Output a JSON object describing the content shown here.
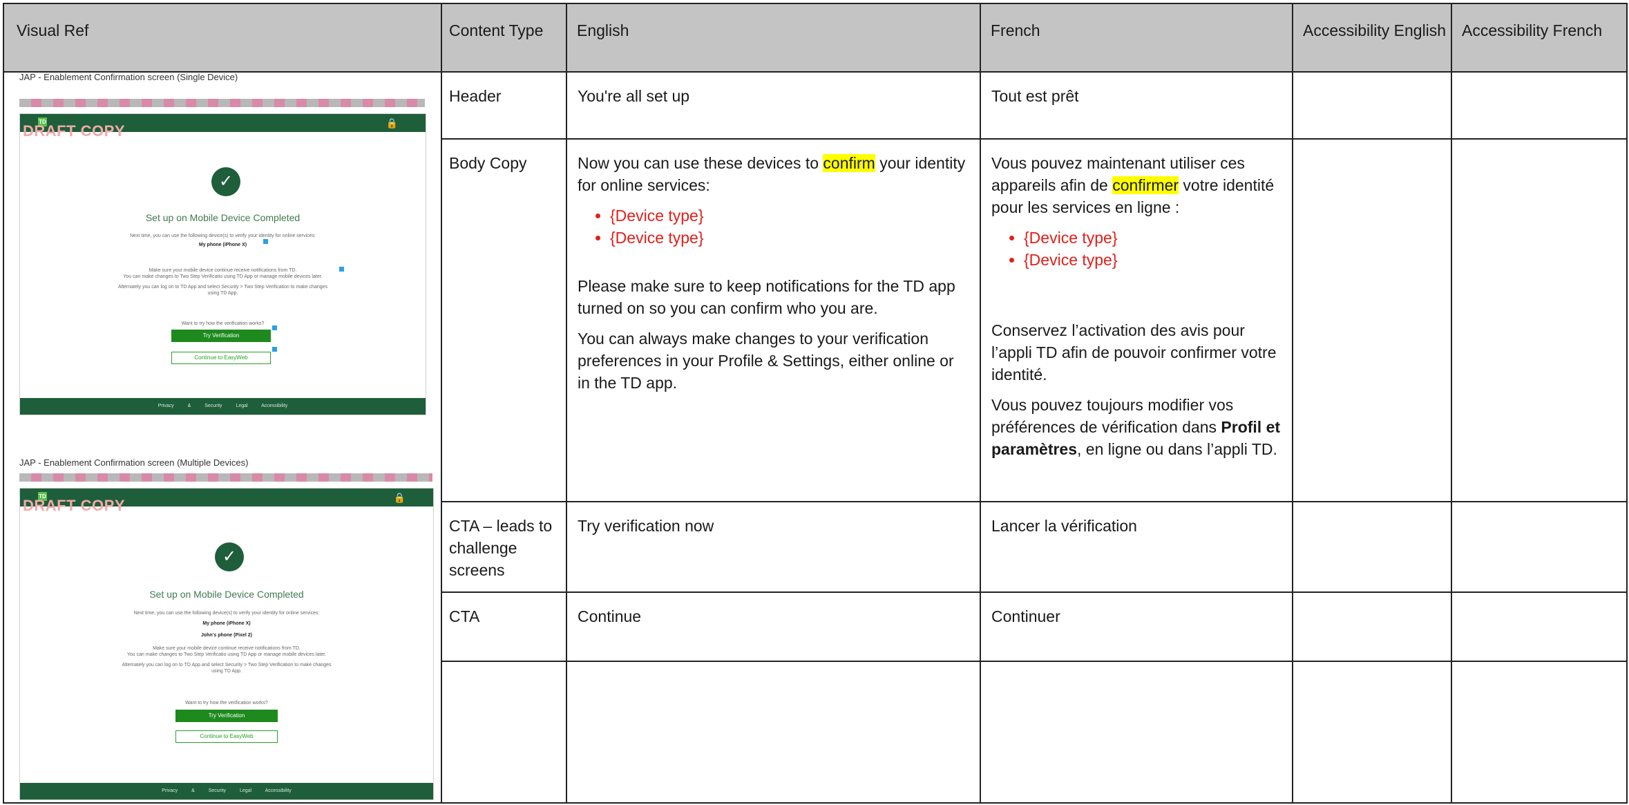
{
  "headers": {
    "visual_ref": "Visual Ref",
    "content_type": "Content Type",
    "english": "English",
    "french": "French",
    "acc_en": "Accessibility English",
    "acc_fr": "Accessibility French"
  },
  "visual": {
    "single": {
      "caption": "JAP - Enablement Confirmation screen (Single Device)",
      "draft": "DRAFT COPY",
      "logo": "TD",
      "title": "Set up on Mobile Device Completed",
      "next_time": "Next time, you can use the following device(s) to verify your identity for online services:",
      "device1": "My phone (iPhone X)",
      "notif": "Make sure your mobile device continue receive notifications from TD.",
      "changes": "You can make changes to Two Step Verificatio using TD App or manage mobile devices later.",
      "alt": "Alternately you can log on to TD App and select Security > Two Step Verification to make changes using TD App.",
      "try_q": "Want to try how the verification works?",
      "try_btn": "Try Verification",
      "cont_btn": "Continue to EasyWeb",
      "footer": "Privacy & Security  Legal  Accessibility"
    },
    "multi": {
      "caption": "JAP - Enablement Confirmation screen (Multiple Devices)",
      "draft": "DRAFT COPY",
      "logo": "TD",
      "title": "Set up on Mobile Device Completed",
      "next_time": "Next time, you can use the following device(s) to verify your identity for online services:",
      "device1": "My phone (iPhone X)",
      "device2": "John's phone (Pixel 2)",
      "notif": "Make sure your mobile device continue receive notifications from TD.",
      "changes": "You can make changes to Two Step Verificatio using TD App or manage mobile devices later.",
      "alt": "Alternately you can log on to TD App and select Security > Two Step Verification to make changes using TD App.",
      "try_q": "Want to try how the verification works?",
      "try_btn": "Try Verification",
      "cont_btn": "Continue to EasyWeb",
      "footer": "Privacy & Security  Legal  Accessibility"
    }
  },
  "rows": {
    "header": {
      "type": "Header",
      "en": "You're all set up",
      "fr": "Tout est prêt"
    },
    "body": {
      "type": "Body Copy",
      "en": {
        "p1_a": "Now you can use these devices to ",
        "p1_hl": "confirm",
        "p1_b": " your identity for online services:",
        "bullets": [
          "{Device type}",
          "{Device type}"
        ],
        "p2": "Please make sure to keep notifications for the TD app turned on so you can confirm who you are.",
        "p3": "You can always make changes to your verification preferences in your Profile & Settings, either online or in the TD app."
      },
      "fr": {
        "p1_a": "Vous pouvez maintenant utiliser ces appareils afin de ",
        "p1_hl": "confirmer",
        "p1_b": " votre identité pour les services en ligne :",
        "bullets": [
          "{Device type}",
          "{Device type}"
        ],
        "p2": "Conservez l’activation des avis pour l’appli TD afin de pouvoir confirmer votre identité.",
        "p3_a": "Vous pouvez toujours modifier vos préférences de vérification dans ",
        "p3_b": "Profil et paramètres",
        "p3_c": ", en ligne ou dans l’appli TD."
      }
    },
    "cta1": {
      "type": "CTA – leads to challenge screens",
      "en": "Try verification now",
      "fr": "Lancer la vérification"
    },
    "cta2": {
      "type": "CTA",
      "en": "Continue",
      "fr": "Continuer"
    }
  },
  "colors": {
    "header_bg": "#c4c4c4",
    "td_green": "#1e5e3a",
    "highlight": "#ffff00",
    "placeholder_red": "#e0201b"
  }
}
